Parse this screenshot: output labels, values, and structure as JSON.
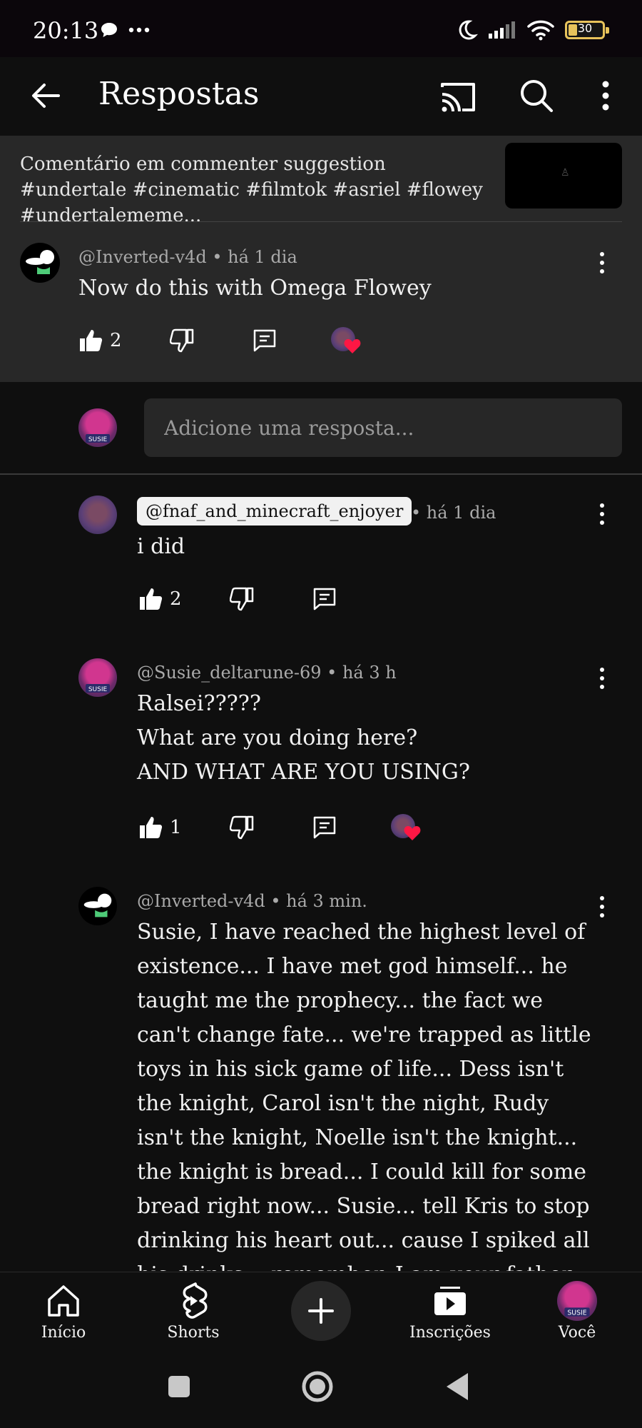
{
  "status_bar": {
    "time": "20:13",
    "battery": "30"
  },
  "app_bar": {
    "title": "Respostas"
  },
  "video": {
    "context_text": "Comentário em commenter suggestion  #undertale #cinematic #filmtok  #asriel #flowey #undertalememe..."
  },
  "parent_comment": {
    "author": "@Inverted-v4d",
    "time": "há 1 dia",
    "text": "Now do this with Omega Flowey",
    "likes": "2"
  },
  "reply_input": {
    "placeholder": "Adicione uma resposta..."
  },
  "replies": [
    {
      "mention": "@fnaf_and_minecraft_enjoyer",
      "time": "• há 1 dia",
      "text": "i did",
      "likes": "2"
    },
    {
      "author": "@Susie_deltarune-69",
      "time": "há 3 h",
      "lines": [
        "Ralsei?????",
        "What are you doing here?",
        "AND WHAT ARE YOU USING?"
      ],
      "likes": "1"
    },
    {
      "author": "@Inverted-v4d",
      "time": "há 3 min.",
      "text": "Susie, I have reached the highest level of existence... I have met god himself... he taught me the prophecy... the fact we can't change fate... we're trapped as little toys in his sick game of life... Dess isn't the knight, Carol isn't the night, Rudy isn't the knight, Noelle isn't the knight... the knight is bread... I could kill for some bread right now... Susie... tell Kris to stop drinking his heart out... cause I spiked all his drinks... remember, I am your father Kris..."
    }
  ],
  "bottom_nav": {
    "home": "Início",
    "shorts": "Shorts",
    "subscriptions": "Inscrições",
    "you": "Você"
  },
  "colors": {
    "background": "#0f0f0f",
    "panel": "#282828",
    "heart": "#ff1744",
    "battery": "#e8c35b"
  }
}
